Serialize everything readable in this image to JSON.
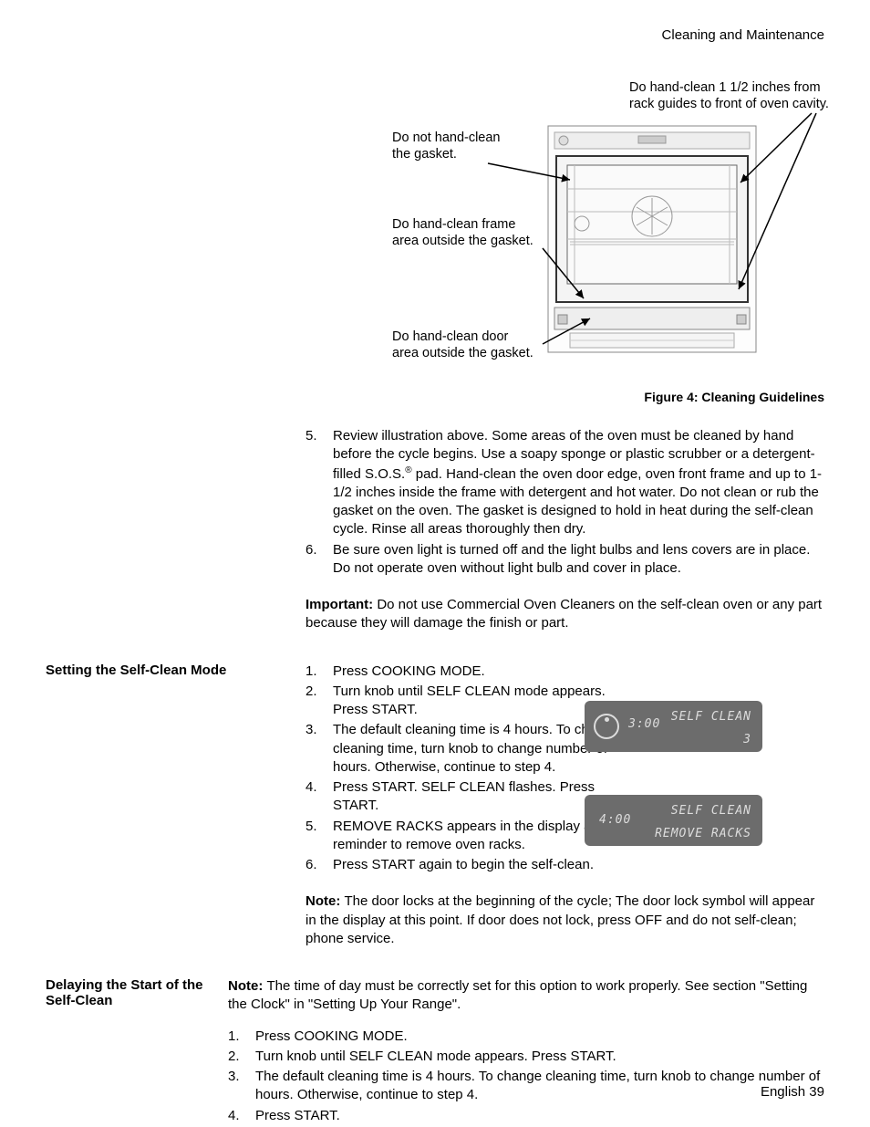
{
  "header": "Cleaning and Maintenance",
  "figure": {
    "callout1": "Do hand-clean 1 1/2 inches from rack guides to front of oven cavity.",
    "callout2a": "Do not hand-clean",
    "callout2b": "the gasket.",
    "callout3a": "Do hand-clean frame",
    "callout3b": "area outside the gasket.",
    "callout4a": "Do hand-clean door",
    "callout4b": "area outside the gasket.",
    "caption": "Figure 4: Cleaning Guidelines"
  },
  "sec1": {
    "steps": {
      "5_part1": "Review illustration above. Some areas of the oven must be cleaned by hand before the cycle begins. Use a soapy sponge or plastic scrubber or a detergent-filled S.O.S.",
      "5_reg": "®",
      "5_part2": " pad. Hand-clean the oven door edge, oven front frame and up to 1-1/2 inches inside the frame with detergent and hot water. Do not clean or rub the gasket on the oven. The gasket is designed to hold in heat during the self-clean cycle. Rinse all areas thoroughly then dry.",
      "6": "Be sure oven light is turned off and the light bulbs and lens covers are in place. Do not operate oven without light bulb and cover in place."
    },
    "important_label": "Important: ",
    "important": "Do not use Commercial Oven Cleaners on the self-clean oven or any part because they will damage the finish or part."
  },
  "sec2": {
    "heading": "Setting the Self-Clean Mode",
    "steps": {
      "1": "Press COOKING MODE.",
      "2": "Turn knob until SELF CLEAN mode appears. Press START.",
      "3": "The default cleaning time is 4 hours. To change cleaning time, turn knob to change number of hours. Otherwise, continue to step 4.",
      "4": "Press START. SELF CLEAN flashes. Press START.",
      "5": "REMOVE RACKS appears in the display as a reminder to remove oven racks.",
      "6": "Press START again to begin the self-clean."
    },
    "display1": {
      "time": "3:00",
      "mode": "SELF CLEAN",
      "sub": "3"
    },
    "display2": {
      "time": "4:00",
      "mode": "SELF CLEAN",
      "sub": "REMOVE RACKS"
    },
    "note_label": "Note: ",
    "note": "The door locks at the beginning of the cycle; The door lock symbol will appear in the display at this point. If door does not lock, press OFF and do not self-clean; phone service."
  },
  "sec3": {
    "heading": "Delaying the Start of the Self-Clean",
    "note_label": "Note: ",
    "note": "The time of day must be correctly set for this option to work properly. See section \"Setting the Clock\" in \"Setting Up Your Range\".",
    "steps": {
      "1": "Press COOKING MODE.",
      "2": "Turn knob until SELF CLEAN mode appears. Press START.",
      "3": "The default cleaning time is 4 hours. To change cleaning time, turn knob to change number of hours. Otherwise, continue to step 4.",
      "4": "Press START."
    }
  },
  "footer": "English 39"
}
